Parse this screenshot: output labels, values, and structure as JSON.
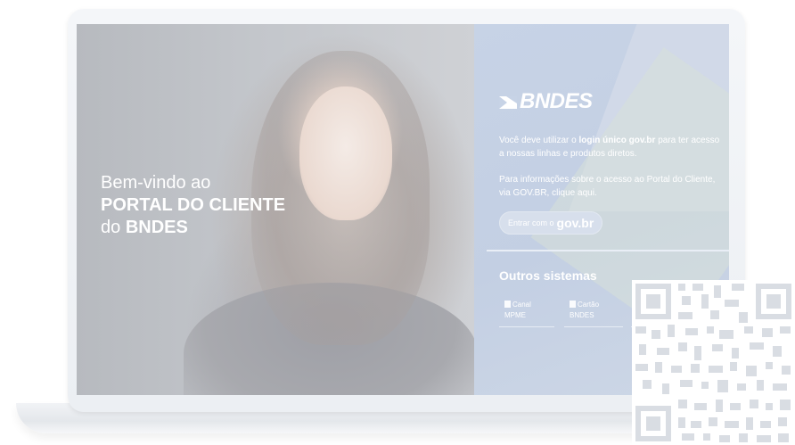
{
  "welcome": {
    "line1": "Bem-vindo ao",
    "line2": "PORTAL DO CLIENTE",
    "line3_prefix": "do ",
    "line3_brand": "BNDES"
  },
  "brand": {
    "name": "BNDES",
    "icon": "bndes-logo-icon"
  },
  "intro": {
    "part1": "Você deve utilizar o ",
    "bold": "login único gov.br",
    "part2": " para ter acesso a nossas linhas e produtos diretos."
  },
  "info": {
    "text": "Para informações sobre o acesso ao Portal do Cliente, via GOV.BR, clique aqui."
  },
  "login_button": {
    "prefix": "Entrar com o",
    "brand": "gov.br"
  },
  "other_systems": {
    "title": "Outros sistemas",
    "items": [
      {
        "line1": "Canal",
        "line2": "MPME",
        "icon": "document-icon"
      },
      {
        "line1": "Cartão",
        "line2": "BNDES",
        "icon": "card-icon"
      },
      {
        "line1": "",
        "line2": "",
        "icon": ""
      }
    ]
  },
  "qr": {
    "icon": "qr-code-icon"
  },
  "colors": {
    "panel": "#c7d3e6",
    "accent_white": "#ffffff"
  }
}
